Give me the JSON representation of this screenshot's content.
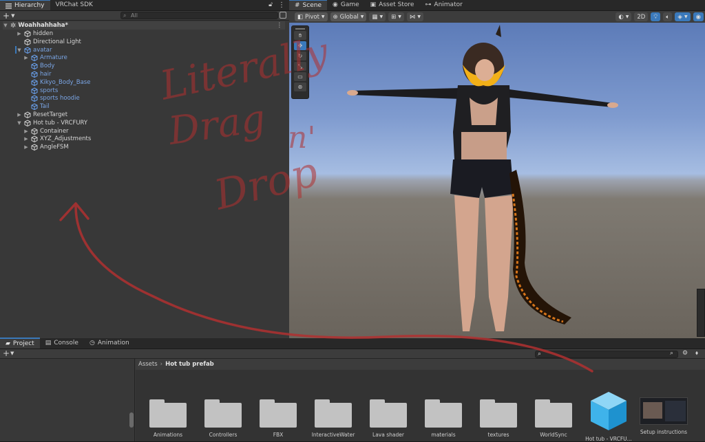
{
  "hierarchy": {
    "tabs": [
      {
        "label": "Hierarchy"
      },
      {
        "label": "VRChat SDK"
      }
    ],
    "search_placeholder": "All",
    "scene_name": "Woahhahhaha*",
    "items": [
      {
        "label": "hidden",
        "color": "white",
        "indent": 1,
        "arrow": "▶"
      },
      {
        "label": "Directional Light",
        "color": "white",
        "indent": 1,
        "arrow": ""
      },
      {
        "label": "avatar",
        "color": "blue",
        "indent": 1,
        "arrow": "▼"
      },
      {
        "label": "Armature",
        "color": "blue",
        "indent": 2,
        "arrow": "▶"
      },
      {
        "label": "Body",
        "color": "blue",
        "indent": 2,
        "arrow": ""
      },
      {
        "label": "hair",
        "color": "blue",
        "indent": 2,
        "arrow": ""
      },
      {
        "label": "Kikyo_Body_Base",
        "color": "blue",
        "indent": 2,
        "arrow": ""
      },
      {
        "label": "sports",
        "color": "blue",
        "indent": 2,
        "arrow": ""
      },
      {
        "label": "sports hoodie",
        "color": "blue",
        "indent": 2,
        "arrow": ""
      },
      {
        "label": "Tail",
        "color": "blue",
        "indent": 2,
        "arrow": ""
      },
      {
        "label": "ResetTarget",
        "color": "white",
        "indent": 1,
        "arrow": "▶"
      },
      {
        "label": "Hot tub - VRCFURY",
        "color": "white",
        "indent": 1,
        "arrow": "▼"
      },
      {
        "label": "Container",
        "color": "white",
        "indent": 2,
        "arrow": "▶"
      },
      {
        "label": "XYZ_Adjustments",
        "color": "white",
        "indent": 2,
        "arrow": "▶"
      },
      {
        "label": "AngleFSM",
        "color": "white",
        "indent": 2,
        "arrow": "▶"
      }
    ]
  },
  "scene": {
    "tabs": [
      {
        "label": "Scene"
      },
      {
        "label": "Game"
      },
      {
        "label": "Asset Store"
      },
      {
        "label": "Animator"
      }
    ],
    "pivot_label": "Pivot",
    "global_label": "Global",
    "mode_2d_label": "2D"
  },
  "project": {
    "tabs": [
      {
        "label": "Project"
      },
      {
        "label": "Console"
      },
      {
        "label": "Animation"
      }
    ],
    "breadcrumb": {
      "root": "Assets",
      "current": "Hot tub prefab"
    },
    "assets": [
      {
        "label": "Animations",
        "kind": "folder"
      },
      {
        "label": "Controllers",
        "kind": "folder"
      },
      {
        "label": "FBX",
        "kind": "folder"
      },
      {
        "label": "InteractiveWater",
        "kind": "folder"
      },
      {
        "label": "Lava shader",
        "kind": "folder"
      },
      {
        "label": "materials",
        "kind": "folder"
      },
      {
        "label": "textures",
        "kind": "folder"
      },
      {
        "label": "WorldSync",
        "kind": "folder"
      },
      {
        "label": "Hot tub - VRCFU...",
        "kind": "prefab"
      },
      {
        "label": "Setup instructions",
        "kind": "image"
      }
    ]
  },
  "annotation": {
    "lines": [
      "Literally",
      "Drag",
      "n'",
      "Drop"
    ],
    "color": "#b03030"
  }
}
